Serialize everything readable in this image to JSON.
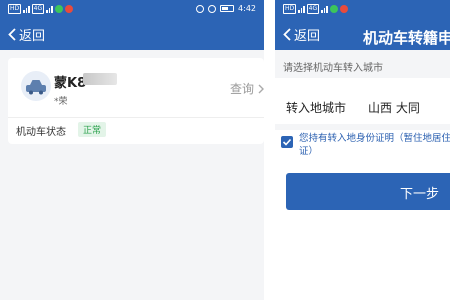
{
  "colors": {
    "brand_blue": "#2c64b5",
    "page_bg": "#f4f5f7",
    "status_green": "#2aa14c",
    "link_blue": "#2a5fb0"
  },
  "left_screen": {
    "statusbar": {
      "network_left": "HD",
      "network_right": "4G",
      "icons": [
        "wechat-icon",
        "alert-icon"
      ],
      "right_icons": [
        "alarm-icon",
        "location-icon",
        "battery-icon"
      ],
      "time": "4:42"
    },
    "navbar": {
      "back_label": "返回",
      "back_icon": "chevron-left-icon"
    },
    "vehicle": {
      "icon": "car-icon",
      "plate": "蒙K8",
      "owner": "*荣",
      "query_label": "查询",
      "query_icon": "chevron-right-icon",
      "status_label": "机动车状态",
      "status_value": "正常"
    }
  },
  "right_screen": {
    "statusbar": {
      "network_left": "HD",
      "network_right": "4G",
      "icons": [
        "wechat-icon",
        "alert-icon"
      ]
    },
    "navbar": {
      "back_label": "返回",
      "back_icon": "chevron-left-icon",
      "title": "机动车转籍申"
    },
    "form": {
      "hint": "请选择机动车转入城市",
      "city_label": "转入地城市",
      "city_value": "山西 大同",
      "checkbox_checked": true,
      "checkbox_text": "您持有转入地身份证明（暂住地居住证）",
      "next_label": "下一步"
    }
  }
}
